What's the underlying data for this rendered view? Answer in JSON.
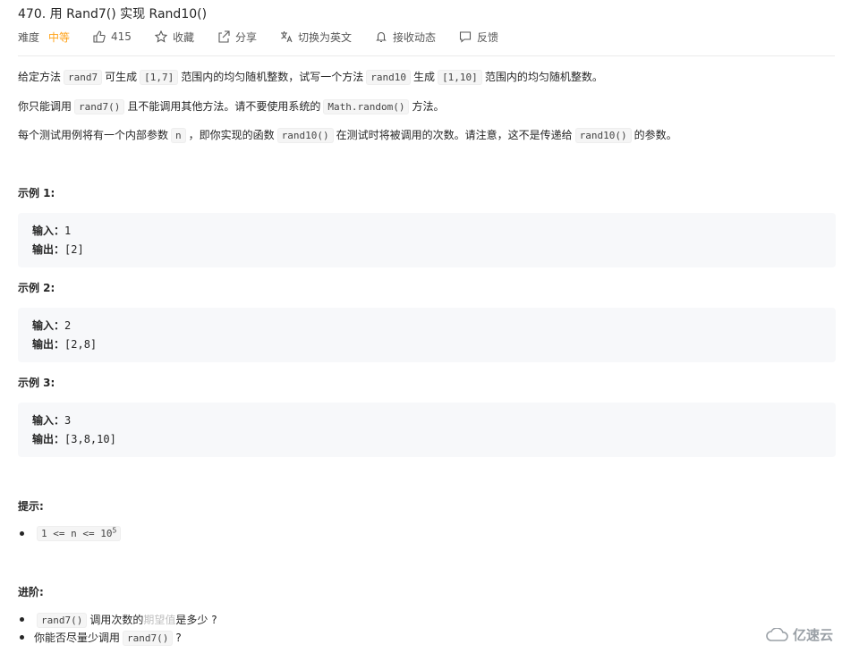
{
  "problem": {
    "title": "470. 用 Rand7() 实现 Rand10()",
    "difficulty_label": "难度",
    "difficulty": "中等",
    "likes": "415",
    "favorite": "收藏",
    "share": "分享",
    "switch_lang": "切换为英文",
    "notify": "接收动态",
    "feedback": "反馈"
  },
  "desc": {
    "p1": [
      "给定方法",
      "rand7",
      "可生成",
      "[1,7]",
      "范围内的均匀随机整数，试写一个方法",
      "rand10",
      "生成",
      "[1,10]",
      "范围内的均匀随机整数。"
    ],
    "p2": [
      "你只能调用",
      "rand7()",
      "且不能调用其他方法。请不要使用系统的",
      "Math.random()",
      "方法。"
    ],
    "p3": [
      "每个测试用例将有一个内部参数",
      "n",
      "，即你实现的函数",
      "rand10()",
      "在测试时将被调用的次数。请注意，这不是传递给",
      "rand10()",
      "的参数。"
    ]
  },
  "examples": [
    {
      "heading": "示例 1:",
      "in_label": "输入：",
      "in": "1",
      "out_label": "输出：",
      "out": "[2]"
    },
    {
      "heading": "示例 2:",
      "in_label": "输入：",
      "in": "2",
      "out_label": "输出：",
      "out": "[2,8]"
    },
    {
      "heading": "示例 3:",
      "in_label": "输入：",
      "in": "3",
      "out_label": "输出：",
      "out": "[3,8,10]"
    }
  ],
  "hints": {
    "heading": "提示:",
    "item1_code": "1 <= n <= 10",
    "item1_sup": "5"
  },
  "advanced": {
    "heading": "进阶:",
    "item1": [
      "rand7()",
      "调用次数的",
      "期望值",
      "是多少 ?"
    ],
    "item2": [
      "你能否尽量少调用",
      "rand7()",
      "?"
    ]
  },
  "watermark": "亿速云",
  "colors": {
    "difficulty": "#ffa116",
    "code_bg": "#f5f5f5",
    "pre_bg": "#f7f8fa"
  }
}
